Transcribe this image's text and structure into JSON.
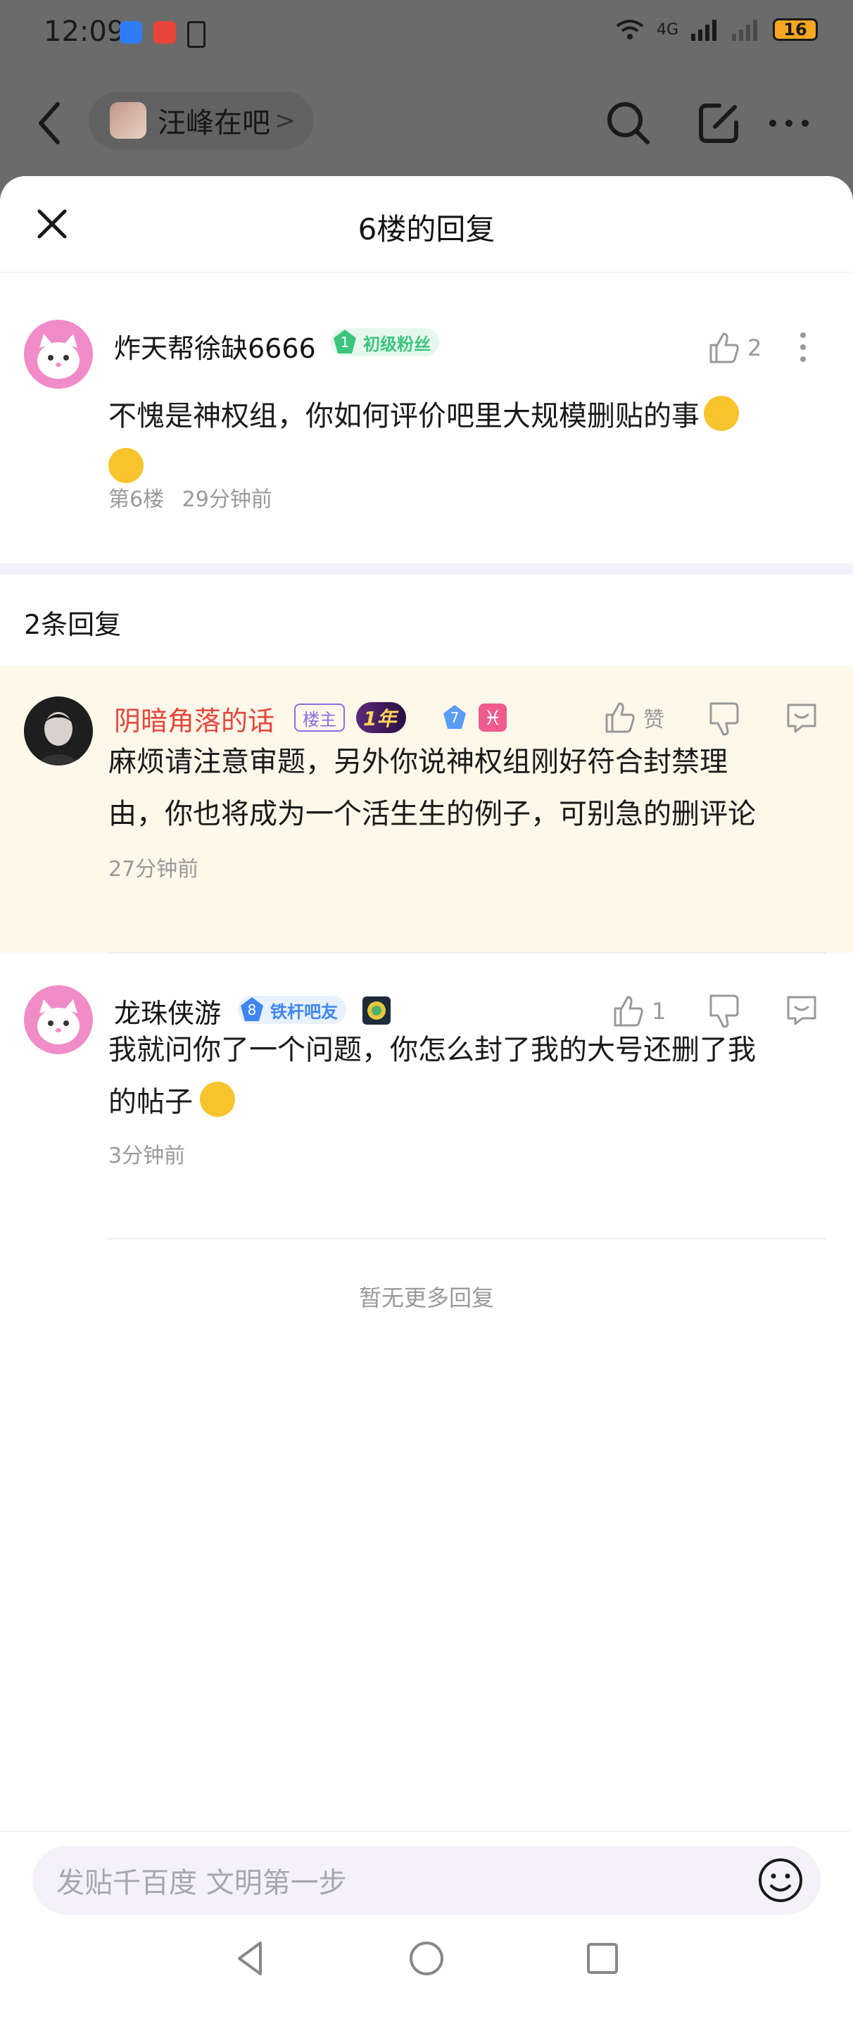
{
  "status_bar": {
    "time": "12:09",
    "battery": "16",
    "net_label": "4G"
  },
  "nav": {
    "forum_name": "汪峰在吧",
    "forum_arrow": ">"
  },
  "sheet": {
    "title": "6楼的回复"
  },
  "main_post": {
    "username": "炸天帮徐缺6666",
    "level": "1",
    "badge": "初级粉丝",
    "like_count": "2",
    "text_line1": "不愧是神权组，你如何评价吧里大规模删贴的事",
    "floor": "第6楼",
    "time": "29分钟前"
  },
  "replies_header": "2条回复",
  "replies": [
    {
      "username": "阴暗角落的话",
      "host_badge": "楼主",
      "year_badge": "1年",
      "level": "7",
      "pisces": "♓",
      "like_label": "赞",
      "text_line1": "麻烦请注意审题，另外你说神权组刚好符合封禁理",
      "text_line2": "由，你也将成为一个活生生的例子，可别急的删评论",
      "time": "27分钟前"
    },
    {
      "username": "龙珠侠游",
      "level": "8",
      "badge": "铁杆吧友",
      "like_count": "1",
      "text_line1": "我就问你了一个问题，你怎么封了我的大号还删了我",
      "text_line2": "的帖子",
      "time": "3分钟前"
    }
  ],
  "no_more": "暂无更多回复",
  "bottom": {
    "placeholder": "发贴千百度 文明第一步"
  },
  "colors": {
    "host_name": "#e5473c",
    "highlight_bg": "#fdf8ea",
    "fan_badge_green": "#3cc47c",
    "tie_badge_blue": "#3f86f0"
  },
  "icons": [
    "back-icon",
    "search-icon",
    "edit-icon",
    "more-icon",
    "close-icon",
    "thumb-up-icon",
    "thumb-down-icon",
    "reply-icon",
    "emoji-icon"
  ]
}
